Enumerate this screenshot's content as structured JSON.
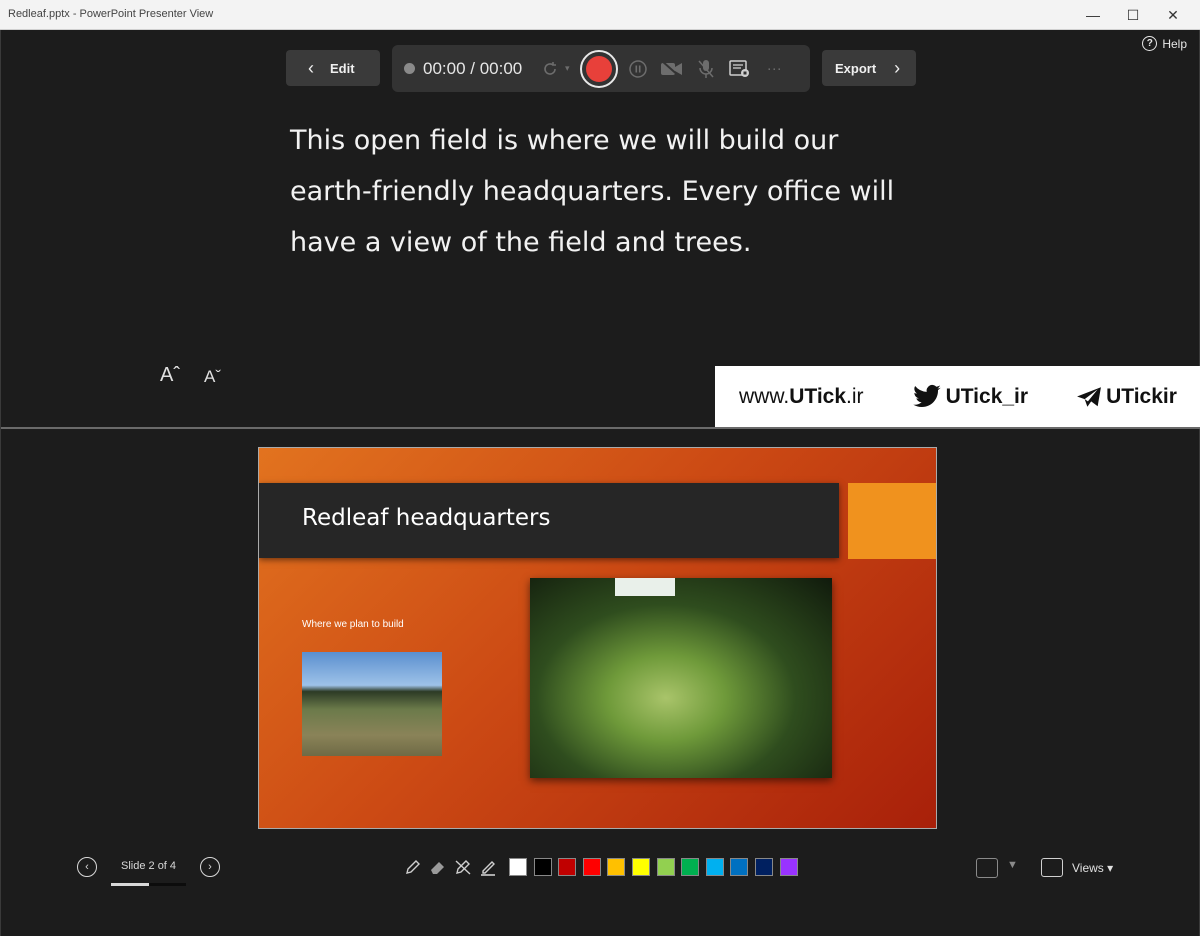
{
  "window": {
    "title": "Redleaf.pptx - PowerPoint Presenter View",
    "minimize": "—",
    "maximize": "☐",
    "close": "✕"
  },
  "help": {
    "label": "Help",
    "icon": "?"
  },
  "toolbar": {
    "edit_label": "Edit",
    "edit_icon": "‹",
    "export_label": "Export",
    "export_icon": "›",
    "timer": "00:00 / 00:00",
    "icons": [
      "retake-icon",
      "record-icon",
      "pause-icon",
      "camera-icon",
      "microphone-icon",
      "teleprompter-icon",
      "more-icon"
    ]
  },
  "notes": {
    "text": "This open field is where we will build our earth-friendly headquarters. Every office will have a view of the field and trees."
  },
  "font_controls": {
    "increase": "Aˆ",
    "decrease": "Aˇ"
  },
  "banner": {
    "website": "www.",
    "website_bold": "UTick",
    "website_suffix": ".ir",
    "twitter": "UTick_ir",
    "telegram": "UTickir"
  },
  "slide": {
    "title": "Redleaf headquarters",
    "subtitle": "Where we plan to build",
    "accent_color": "#f0921e"
  },
  "navigation": {
    "prev_icon": "‹",
    "next_icon": "›",
    "slide_counter": "Slide 2 of 4",
    "progress_fraction": 0.5
  },
  "ink_tools": {
    "items": [
      "pen-icon",
      "eraser-icon",
      "erase-all-icon",
      "highlighter-icon"
    ],
    "colors": [
      "#ffffff",
      "#000000",
      "#c00000",
      "#ff0000",
      "#ffc000",
      "#ffff00",
      "#92d050",
      "#00b050",
      "#00b0f0",
      "#0070c0",
      "#002060",
      "#9933ff"
    ]
  },
  "views": {
    "label": "Views ▾"
  }
}
